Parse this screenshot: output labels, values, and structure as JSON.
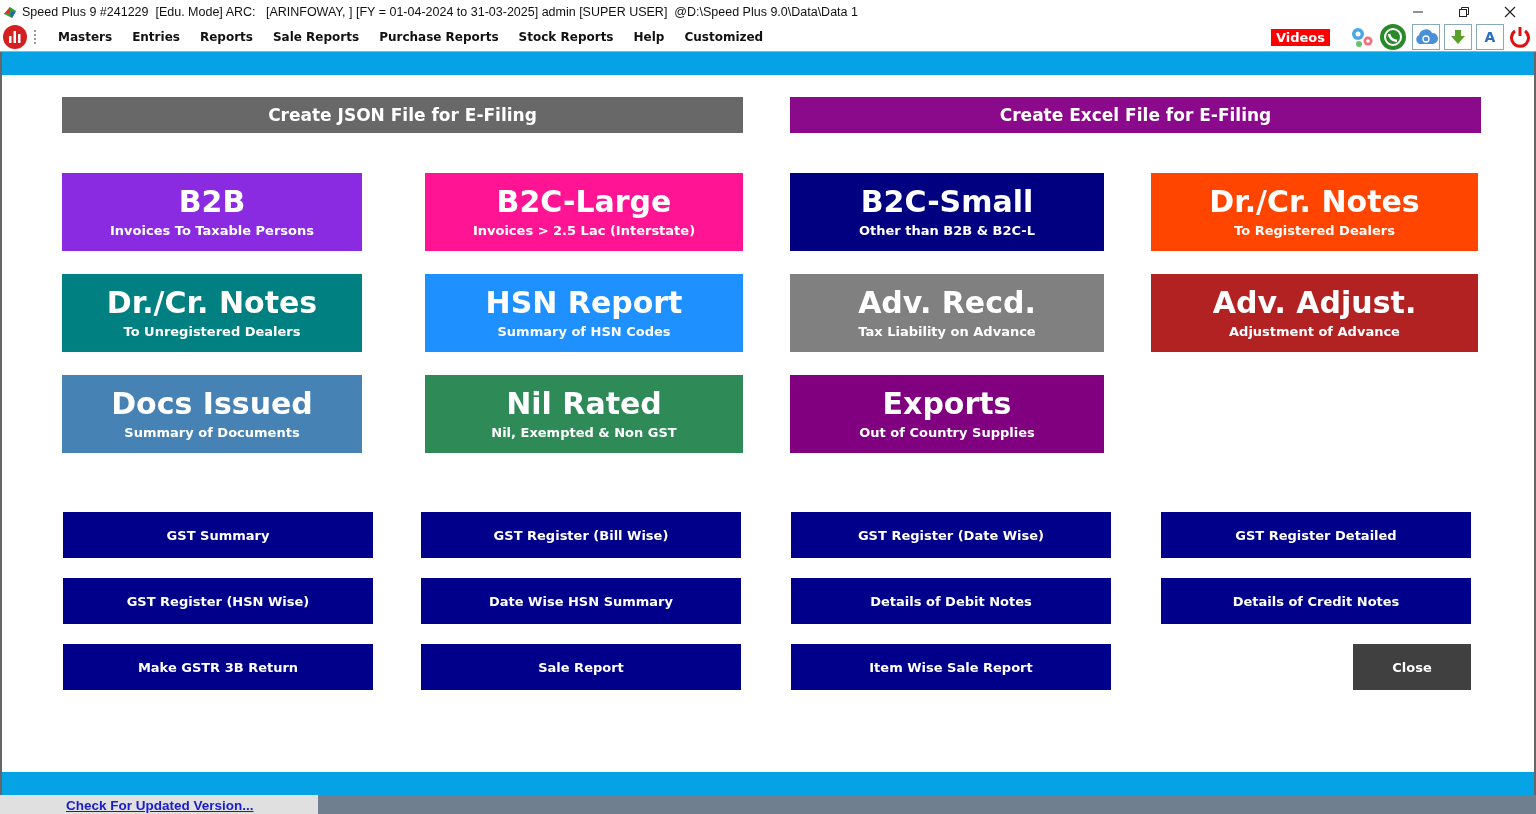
{
  "window": {
    "title": "Speed Plus 9 #241229  [Edu. Mode] ARC:   [ARINFOWAY, ] [FY = 01-04-2024 to 31-03-2025] admin [SUPER USER]  @D:\\Speed Plus 9.0\\Data\\Data 1"
  },
  "menu": [
    "Masters",
    "Entries",
    "Reports",
    "Sale Reports",
    "Purchase Reports",
    "Stock Reports",
    "Help",
    "Customized"
  ],
  "toolbar": {
    "videos_label": "Videos",
    "font_button_label": "A"
  },
  "efiling_buttons": [
    {
      "label": "Create JSON File for E-Filing",
      "color": "#686868"
    },
    {
      "label": "Create Excel File for E-Filing",
      "color": "#8b0a8b"
    }
  ],
  "tiles": [
    {
      "title": "B2B",
      "subtitle": "Invoices To Taxable Persons",
      "color": "#8a2be2"
    },
    {
      "title": "B2C-Large",
      "subtitle": "Invoices > 2.5 Lac (Interstate)",
      "color": "#ff1493"
    },
    {
      "title": "B2C-Small",
      "subtitle": "Other than B2B & B2C-L",
      "color": "#000080"
    },
    {
      "title": "Dr./Cr. Notes",
      "subtitle": "To Registered Dealers",
      "color": "#ff4500"
    },
    {
      "title": "Dr./Cr. Notes",
      "subtitle": "To Unregistered Dealers",
      "color": "#008080"
    },
    {
      "title": "HSN Report",
      "subtitle": "Summary of HSN Codes",
      "color": "#1e90ff"
    },
    {
      "title": "Adv. Recd.",
      "subtitle": "Tax Liability on Advance",
      "color": "#808080"
    },
    {
      "title": "Adv. Adjust.",
      "subtitle": "Adjustment of Advance",
      "color": "#b22222"
    },
    {
      "title": "Docs Issued",
      "subtitle": "Summary of Documents",
      "color": "#4682b4"
    },
    {
      "title": "Nil Rated",
      "subtitle": "Nil, Exempted & Non GST",
      "color": "#2e8b57"
    },
    {
      "title": "Exports",
      "subtitle": "Out of Country Supplies",
      "color": "#800080"
    }
  ],
  "report_buttons": [
    {
      "label": "GST Summary",
      "kind": "report"
    },
    {
      "label": "GST Register (Bill Wise)",
      "kind": "report"
    },
    {
      "label": "GST Register (Date Wise)",
      "kind": "report"
    },
    {
      "label": "GST Register Detailed",
      "kind": "report"
    },
    {
      "label": "GST Register (HSN Wise)",
      "kind": "report"
    },
    {
      "label": "Date Wise HSN Summary",
      "kind": "report"
    },
    {
      "label": "Details of Debit Notes",
      "kind": "report"
    },
    {
      "label": "Details of Credit Notes",
      "kind": "report"
    },
    {
      "label": "Make GSTR 3B Return",
      "kind": "report"
    },
    {
      "label": "Sale Report",
      "kind": "report"
    },
    {
      "label": "Item Wise Sale Report",
      "kind": "report"
    },
    {
      "label": "Close",
      "kind": "close"
    }
  ],
  "status_bar": {
    "link": "Check For Updated Version..."
  }
}
